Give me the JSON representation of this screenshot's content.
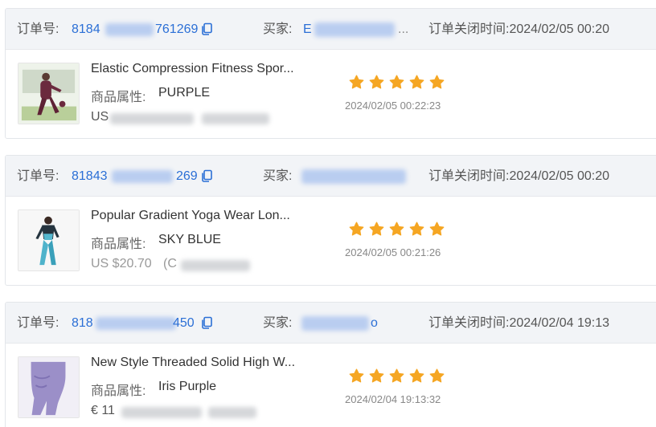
{
  "labels": {
    "order_no": "订单号:",
    "buyer": "买家:",
    "attr": "商品属性:"
  },
  "orders": [
    {
      "order_no": "8184",
      "order_no_tail": "761269",
      "buyer": "E",
      "buyer_tail": "...",
      "close_time": "订单关闭时间:2024/02/05 00:20",
      "product_title": "Elastic Compression Fitness Spor...",
      "attr_value": "PURPLE",
      "price_prefix": "US",
      "price_suffix": "",
      "review_time": "2024/02/05 00:22:23",
      "rating": 5
    },
    {
      "order_no": "81843",
      "order_no_tail": "269",
      "buyer": "",
      "buyer_tail": "",
      "close_time": "订单关闭时间:2024/02/05 00:20",
      "product_title": "Popular Gradient Yoga Wear Lon...",
      "attr_value": "SKY BLUE",
      "price_prefix": "US $20.70",
      "price_suffix": "(C",
      "review_time": "2024/02/05 00:21:26",
      "rating": 5
    },
    {
      "order_no": "818",
      "order_no_tail": "450",
      "buyer": "",
      "buyer_tail": "o",
      "close_time": "订单关闭时间:2024/02/04 19:13",
      "product_title": "New Style Threaded Solid High W...",
      "attr_value": "Iris Purple",
      "price_prefix": "€ 11",
      "price_suffix": "",
      "review_time": "2024/02/04 19:13:32",
      "rating": 5
    }
  ],
  "colors": {
    "link_blue": "#2b6fd6",
    "star": "#f5a623",
    "header_bg": "#f2f4f7"
  },
  "icons": {
    "copy": "copy-icon",
    "star": "star-icon"
  }
}
